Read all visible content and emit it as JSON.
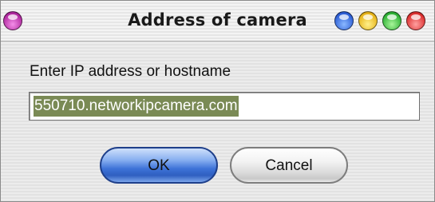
{
  "window": {
    "title": "Address of camera"
  },
  "title_buttons": [
    "purple-orb",
    "blue-orb",
    "yellow-orb",
    "green-orb",
    "red-orb"
  ],
  "form": {
    "prompt": "Enter IP address or hostname",
    "ip_value": "550710.networkipcamera.com"
  },
  "buttons": {
    "ok_label": "OK",
    "cancel_label": "Cancel"
  },
  "colors": {
    "ok_button": "#3e73d8",
    "selection": "#7a8a55",
    "close_orb": "#dd3030"
  }
}
